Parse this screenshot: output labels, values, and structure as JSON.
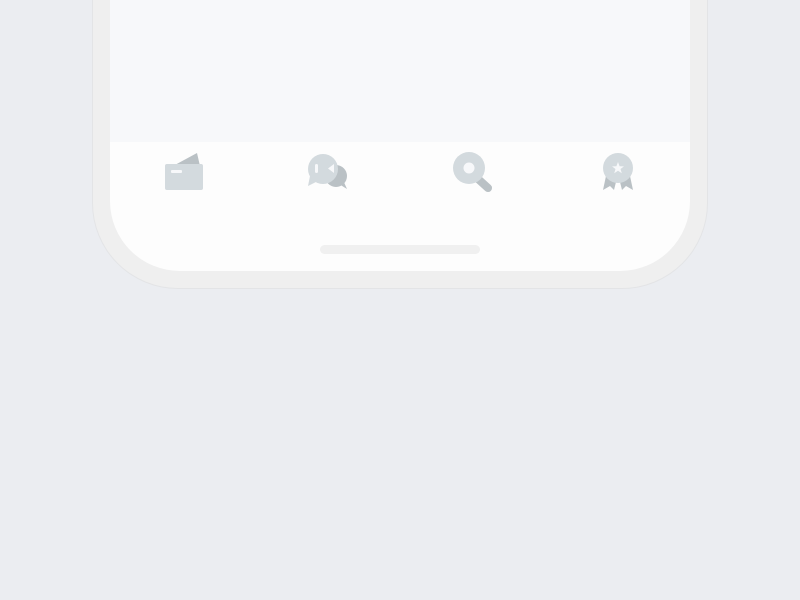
{
  "colors": {
    "background": "#EBEDF1",
    "bezel": "#EFEFEF",
    "screen": "#FDFDFD",
    "content": "#F7F8FA",
    "icon_light": "#D3DADE",
    "icon_dark": "#BAC1C5",
    "home_indicator": "#F0F0F0"
  },
  "tab_bar": {
    "tabs": [
      {
        "icon": "wallet-icon"
      },
      {
        "icon": "chat-bubbles-icon"
      },
      {
        "icon": "search-icon"
      },
      {
        "icon": "award-badge-icon"
      }
    ]
  }
}
